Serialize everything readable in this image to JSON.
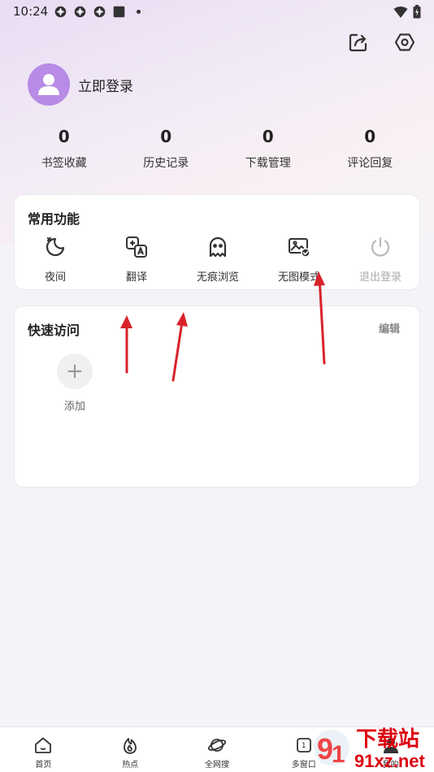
{
  "status_bar": {
    "time": "10:24"
  },
  "profile": {
    "login_label": "立即登录"
  },
  "stats": [
    {
      "value": "0",
      "label": "书签收藏"
    },
    {
      "value": "0",
      "label": "历史记录"
    },
    {
      "value": "0",
      "label": "下载管理"
    },
    {
      "value": "0",
      "label": "评论回复"
    }
  ],
  "functions": {
    "title": "常用功能",
    "items": [
      {
        "label": "夜间",
        "icon": "moon-icon"
      },
      {
        "label": "翻译",
        "icon": "translate-icon"
      },
      {
        "label": "无痕浏览",
        "icon": "ghost-icon"
      },
      {
        "label": "无图模式",
        "icon": "no-image-icon"
      },
      {
        "label": "退出登录",
        "icon": "power-icon"
      }
    ]
  },
  "quick_access": {
    "title": "快速访问",
    "edit_label": "编辑",
    "add_label": "添加"
  },
  "bottom_nav": [
    {
      "label": "首页",
      "icon": "home-icon"
    },
    {
      "label": "热点",
      "icon": "flame-icon"
    },
    {
      "label": "全网搜",
      "icon": "planet-icon"
    },
    {
      "label": "多窗口",
      "icon": "window-icon",
      "badge": "1"
    },
    {
      "label": "我的",
      "icon": "user-icon"
    }
  ],
  "watermark": {
    "text_top": "下载站",
    "text_bottom": "91xz.net"
  },
  "colors": {
    "accent_avatar": "#b78be6",
    "arrow_red": "#d9232a"
  }
}
